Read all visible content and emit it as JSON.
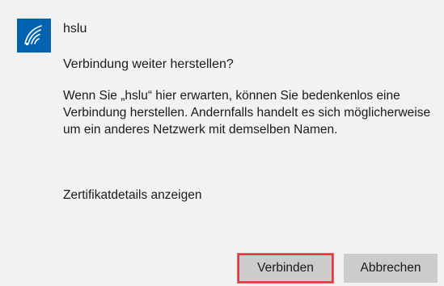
{
  "network": {
    "icon": "wifi-icon",
    "name": "hslu"
  },
  "dialog": {
    "question": "Verbindung weiter herstellen?",
    "explanation": "Wenn Sie „hslu“ hier erwarten, können Sie bedenkenlos eine Verbindung herstellen. Andernfalls handelt es sich möglicherweise um ein anderes Netzwerk mit demselben Namen.",
    "certificate_link": "Zertifikatdetails anzeigen"
  },
  "buttons": {
    "connect_label": "Verbinden",
    "cancel_label": "Abbrechen"
  },
  "colors": {
    "accent": "#0063b1",
    "background": "#f2f2f2",
    "button": "#cccccc",
    "highlight": "#e0383f"
  }
}
